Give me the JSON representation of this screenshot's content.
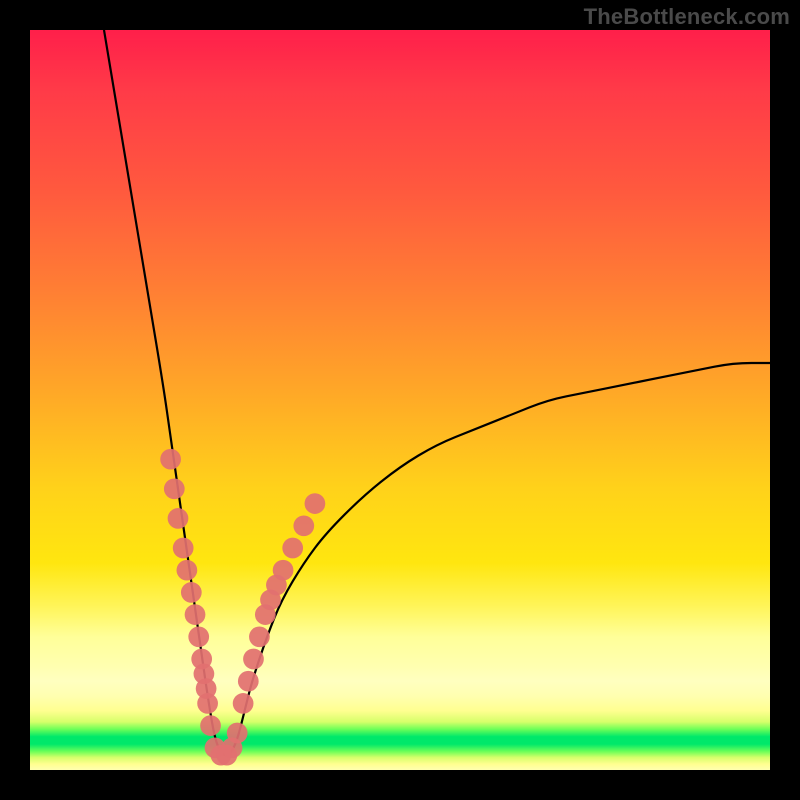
{
  "watermark": "TheBottleneck.com",
  "colors": {
    "frame": "#000000",
    "curve": "#000000",
    "dot": "#e27070",
    "gradient_top": "#ff1f4a",
    "gradient_mid": "#ffd21a",
    "gradient_green": "#00e86a"
  },
  "chart_data": {
    "type": "line",
    "title": "",
    "xlabel": "",
    "ylabel": "",
    "xlim": [
      0,
      100
    ],
    "ylim": [
      0,
      100
    ],
    "legend": false,
    "grid": false,
    "series": [
      {
        "name": "bottleneck-v-curve",
        "description": "Black V-shaped curve dipping to the bottom around x≈25 and rising toward ~55 at x=100",
        "x": [
          10,
          12,
          14,
          16,
          18,
          19,
          20,
          21,
          22,
          23,
          24,
          25,
          26,
          27,
          28,
          29,
          30,
          32,
          34,
          37,
          40,
          45,
          50,
          55,
          60,
          65,
          70,
          75,
          80,
          85,
          90,
          95,
          100
        ],
        "values": [
          100,
          88,
          76,
          64,
          52,
          45,
          38,
          31,
          24,
          17,
          10,
          4,
          2,
          2,
          4,
          8,
          12,
          18,
          23,
          28,
          32,
          37,
          41,
          44,
          46,
          48,
          50,
          51,
          52,
          53,
          54,
          55,
          55
        ]
      }
    ],
    "scatter_overlay": {
      "name": "pink-dots",
      "description": "Coral/pink dots clustered along the lower part of the V-curve",
      "points": [
        {
          "x": 19.0,
          "y": 42
        },
        {
          "x": 19.5,
          "y": 38
        },
        {
          "x": 20.0,
          "y": 34
        },
        {
          "x": 20.7,
          "y": 30
        },
        {
          "x": 21.2,
          "y": 27
        },
        {
          "x": 21.8,
          "y": 24
        },
        {
          "x": 22.3,
          "y": 21
        },
        {
          "x": 22.8,
          "y": 18
        },
        {
          "x": 23.2,
          "y": 15
        },
        {
          "x": 23.5,
          "y": 13
        },
        {
          "x": 23.8,
          "y": 11
        },
        {
          "x": 24.0,
          "y": 9
        },
        {
          "x": 24.4,
          "y": 6
        },
        {
          "x": 25.0,
          "y": 3
        },
        {
          "x": 25.8,
          "y": 2
        },
        {
          "x": 26.6,
          "y": 2
        },
        {
          "x": 27.3,
          "y": 3
        },
        {
          "x": 28.0,
          "y": 5
        },
        {
          "x": 28.8,
          "y": 9
        },
        {
          "x": 29.5,
          "y": 12
        },
        {
          "x": 30.2,
          "y": 15
        },
        {
          "x": 31.0,
          "y": 18
        },
        {
          "x": 31.8,
          "y": 21
        },
        {
          "x": 32.5,
          "y": 23
        },
        {
          "x": 33.3,
          "y": 25
        },
        {
          "x": 34.2,
          "y": 27
        },
        {
          "x": 35.5,
          "y": 30
        },
        {
          "x": 37.0,
          "y": 33
        },
        {
          "x": 38.5,
          "y": 36
        }
      ],
      "radius": 1.4
    },
    "background_gradient": {
      "direction": "vertical",
      "stops": [
        {
          "y": 100,
          "color": "#ff1f4a"
        },
        {
          "y": 50,
          "color": "#ffd21a"
        },
        {
          "y": 14,
          "color": "#ffffb0"
        },
        {
          "y": 5,
          "color": "#00e86a"
        },
        {
          "y": 0,
          "color": "#ffffb0"
        }
      ]
    }
  }
}
